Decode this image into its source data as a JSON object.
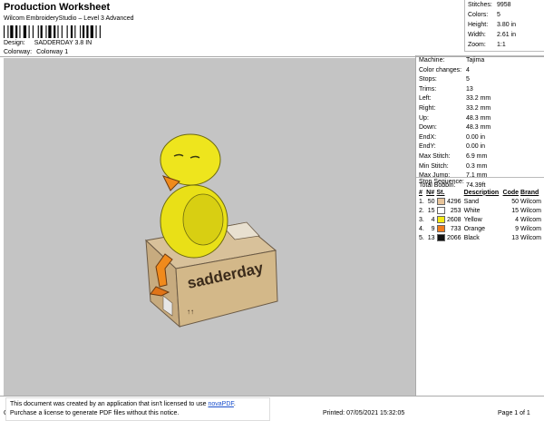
{
  "header": {
    "title": "Production Worksheet",
    "software": "Wilcom EmbroideryStudio – Level 3 Advanced",
    "design_label": "Design:",
    "design_value": "SADDERDAY 3.8 IN",
    "colorway_label": "Colorway:",
    "colorway_value": "Colorway 1"
  },
  "summary": [
    {
      "k": "Stitches:",
      "v": "9958"
    },
    {
      "k": "Colors:",
      "v": "5"
    },
    {
      "k": "Height:",
      "v": "3.80 in"
    },
    {
      "k": "Width:",
      "v": "2.61 in"
    },
    {
      "k": "Zoom:",
      "v": "1:1"
    }
  ],
  "machine": [
    {
      "k": "Machine:",
      "v": "Tajima"
    },
    {
      "k": "Color changes:",
      "v": "4"
    },
    {
      "k": "Stops:",
      "v": "5"
    },
    {
      "k": "Trims:",
      "v": "13"
    },
    {
      "k": "Left:",
      "v": "33.2 mm"
    },
    {
      "k": "Right:",
      "v": "33.2 mm"
    },
    {
      "k": "Up:",
      "v": "48.3 mm"
    },
    {
      "k": "Down:",
      "v": "48.3 mm"
    },
    {
      "k": "EndX:",
      "v": "0.00 in"
    },
    {
      "k": "EndY:",
      "v": "0.00 in"
    },
    {
      "k": "Max Stitch:",
      "v": "6.9 mm"
    },
    {
      "k": "Min Stitch:",
      "v": "0.3 mm"
    },
    {
      "k": "Max Jump:",
      "v": "7.1 mm"
    },
    {
      "k": "Total Bobbin:",
      "v": "74.39ft"
    }
  ],
  "stop_sequence": {
    "title": "Stop Sequence:",
    "headers": [
      "#",
      "N#",
      "St.",
      "Description",
      "Code",
      "Brand"
    ],
    "rows": [
      {
        "n": "1.",
        "nn": "50",
        "st": "4296",
        "desc": "Sand",
        "code": "50",
        "brand": "Wilcom",
        "color": "#e8c49a"
      },
      {
        "n": "2.",
        "nn": "15",
        "st": "253",
        "desc": "White",
        "code": "15",
        "brand": "Wilcom",
        "color": "#ffffff"
      },
      {
        "n": "3.",
        "nn": "4",
        "st": "2608",
        "desc": "Yellow",
        "code": "4",
        "brand": "Wilcom",
        "color": "#f5ea14"
      },
      {
        "n": "4.",
        "nn": "9",
        "st": "733",
        "desc": "Orange",
        "code": "9",
        "brand": "Wilcom",
        "color": "#f07c1c"
      },
      {
        "n": "5.",
        "nn": "13",
        "st": "2066",
        "desc": "Black",
        "code": "13",
        "brand": "Wilcom",
        "color": "#111111"
      }
    ]
  },
  "artwork": {
    "box_text": "sadderday"
  },
  "notice": {
    "line1_pre": "This document was created by an application that isn't licensed to use ",
    "link": "novaPDF",
    "line1_post": ".",
    "line2": "Purchase a license to generate PDF files without this notice."
  },
  "footer": {
    "left": "Cr",
    "printed": "Printed: 07/05/2021 15:32:05",
    "page": "Page 1 of 1"
  }
}
